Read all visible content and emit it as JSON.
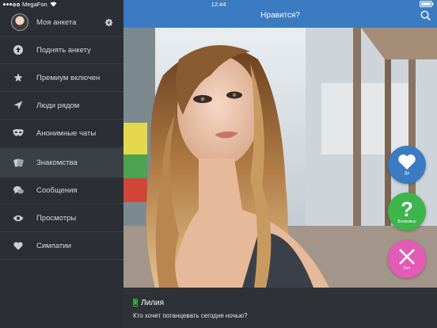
{
  "statusbar": {
    "carrier": "MegaFon",
    "time": "12:44"
  },
  "sidebar": {
    "items": [
      {
        "label": "Моя анкета",
        "icon": "avatar"
      },
      {
        "label": "Поднять анкету",
        "icon": "arrow-up-circle-icon"
      },
      {
        "label": "Премиум включен",
        "icon": "star-icon"
      },
      {
        "label": "Люди рядом",
        "icon": "location-arrow-icon"
      },
      {
        "label": "Анонимные чаты",
        "icon": "mask-icon"
      },
      {
        "label": "Знакомства",
        "icon": "cards-icon"
      },
      {
        "label": "Сообщения",
        "icon": "chat-bubbles-icon"
      },
      {
        "label": "Просмотры",
        "icon": "eye-icon"
      },
      {
        "label": "Симпатии",
        "icon": "heart-icon"
      }
    ],
    "active_index": 5
  },
  "header": {
    "title": "Нравится?"
  },
  "actions": {
    "yes": {
      "label": "Да",
      "color": "#3a7bc2"
    },
    "maybe": {
      "label": "Возможно",
      "color": "#3cb54a"
    },
    "no": {
      "label": "Нет",
      "color": "#e35bb5"
    }
  },
  "profile": {
    "name": "Лилия",
    "status_text": "Кто хочет потанцевать сегодня ночью?",
    "online_color": "#3cb54a"
  },
  "colors": {
    "accent": "#3a7bc2",
    "sidebar": "#2b2e34"
  }
}
